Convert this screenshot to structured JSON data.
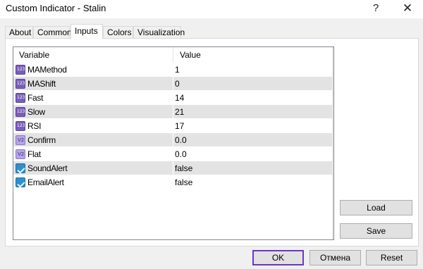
{
  "window": {
    "title": "Custom Indicator - Stalin",
    "help_glyph": "?",
    "close_glyph": "✕"
  },
  "tabs": [
    {
      "label": "About"
    },
    {
      "label": "Common"
    },
    {
      "label": "Inputs",
      "active": true
    },
    {
      "label": "Colors"
    },
    {
      "label": "Visualization"
    }
  ],
  "grid": {
    "columns": [
      "Variable",
      "Value"
    ],
    "rows": [
      {
        "name": "MAMethod",
        "value": "1",
        "icon": "integer-icon"
      },
      {
        "name": "MAShift",
        "value": "0",
        "icon": "integer-icon"
      },
      {
        "name": "Fast",
        "value": "14",
        "icon": "integer-icon"
      },
      {
        "name": "Slow",
        "value": "21",
        "icon": "integer-icon"
      },
      {
        "name": "RSI",
        "value": "17",
        "icon": "integer-icon"
      },
      {
        "name": "Confirm",
        "value": "0.0",
        "icon": "double-icon"
      },
      {
        "name": "Flat",
        "value": "0.0",
        "icon": "double-icon"
      },
      {
        "name": "SoundAlert",
        "value": "false",
        "icon": "boolean-icon"
      },
      {
        "name": "EmailAlert",
        "value": "false",
        "icon": "boolean-icon"
      }
    ]
  },
  "side_buttons": {
    "load": "Load",
    "save": "Save"
  },
  "bottom_buttons": {
    "ok": "OK",
    "cancel": "Отмена",
    "reset": "Reset"
  },
  "colors": {
    "ok_border": "#6b36c9",
    "row_alt": "#e3e3e3"
  }
}
